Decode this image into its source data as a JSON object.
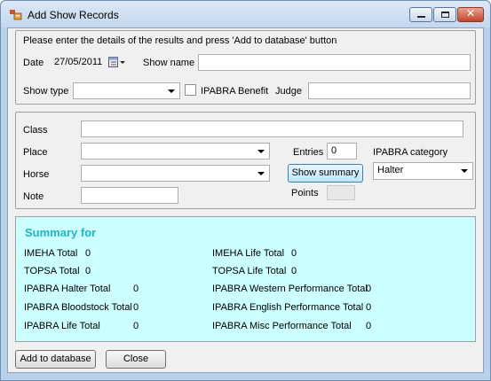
{
  "window": {
    "title": "Add Show Records"
  },
  "instructions": "Please enter the details of the results and press 'Add to database' button",
  "date": {
    "label": "Date",
    "value": "27/05/2011"
  },
  "show_name": {
    "label": "Show name",
    "value": ""
  },
  "show_type": {
    "label": "Show type",
    "value": ""
  },
  "ipabra_benefit": {
    "label": "IPABRA Benefit",
    "checked": false
  },
  "judge": {
    "label": "Judge",
    "value": ""
  },
  "class": {
    "label": "Class",
    "value": ""
  },
  "place": {
    "label": "Place",
    "value": ""
  },
  "horse": {
    "label": "Horse",
    "value": ""
  },
  "note": {
    "label": "Note",
    "value": ""
  },
  "entries": {
    "label": "Entries",
    "value": "0"
  },
  "points": {
    "label": "Points",
    "value": ""
  },
  "ipabra_category": {
    "label": "IPABRA category",
    "value": "Halter"
  },
  "show_summary_label": "Show summary",
  "summary": {
    "title": "Summary  for",
    "left": [
      {
        "label": "IMEHA Total",
        "value": "0"
      },
      {
        "label": "TOPSA Total",
        "value": "0"
      },
      {
        "label": "IPABRA Halter Total",
        "value": "0"
      },
      {
        "label": "IPABRA Bloodstock Total",
        "value": "0"
      },
      {
        "label": "IPABRA Life Total",
        "value": "0"
      }
    ],
    "right": [
      {
        "label": "IMEHA Life Total",
        "value": "0"
      },
      {
        "label": "TOPSA Life Total",
        "value": "0"
      },
      {
        "label": "IPABRA Western Performance Total",
        "value": "0"
      },
      {
        "label": "IPABRA English Performance Total",
        "value": "0"
      },
      {
        "label": "IPABRA Misc Performance Total",
        "value": "0"
      }
    ]
  },
  "buttons": {
    "add": "Add to database",
    "close": "Close"
  },
  "icons": {
    "app": "app-icon",
    "calendar": "calendar-icon"
  },
  "colors": {
    "summary_bg": "#ccffff",
    "summary_title": "#1fb5c4"
  }
}
